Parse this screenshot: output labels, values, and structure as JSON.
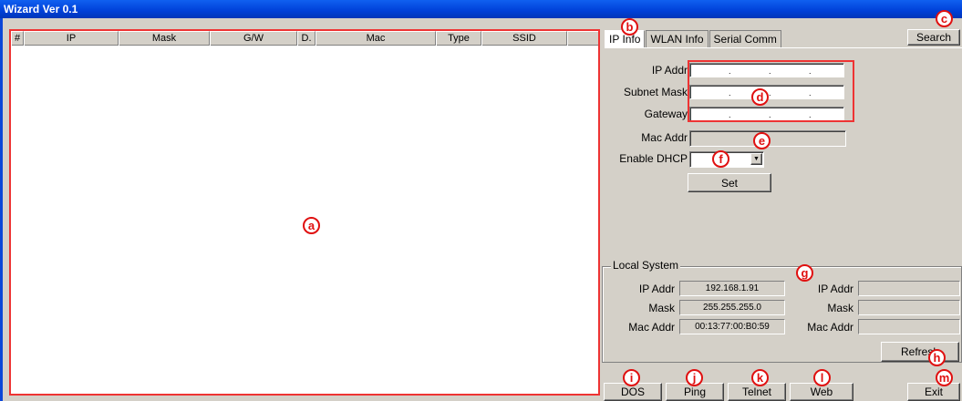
{
  "window": {
    "title": "Wizard Ver 0.1"
  },
  "device_list": {
    "columns": [
      "#",
      "IP",
      "Mask",
      "G/W",
      "D.",
      "Mac",
      "Type",
      "SSID"
    ],
    "marker": "a"
  },
  "tabs": [
    {
      "label": "IP Info",
      "active": true
    },
    {
      "label": "WLAN Info",
      "active": false
    },
    {
      "label": "Serial Comm",
      "active": false
    }
  ],
  "search_button": "Search",
  "ip_info": {
    "ip_addr_label": "IP Addr",
    "subnet_mask_label": "Subnet Mask",
    "gateway_label": "Gateway",
    "mac_addr_label": "Mac Addr",
    "enable_dhcp_label": "Enable DHCP",
    "dhcp_value": "",
    "set_button": "Set"
  },
  "local_system": {
    "legend": "Local System",
    "left": {
      "ip_label": "IP Addr",
      "ip_value": "192.168.1.91",
      "mask_label": "Mask",
      "mask_value": "255.255.255.0",
      "mac_label": "Mac Addr",
      "mac_value": "00:13:77:00:B0:59"
    },
    "right": {
      "ip_label": "IP Addr",
      "ip_value": "",
      "mask_label": "Mask",
      "mask_value": "",
      "mac_label": "Mac Addr",
      "mac_value": ""
    },
    "refresh_button": "Refresh"
  },
  "bottom_buttons": {
    "dos": "DOS",
    "ping": "Ping",
    "telnet": "Telnet",
    "web": "Web",
    "exit": "Exit"
  },
  "markers": {
    "a": "a",
    "b": "b",
    "c": "c",
    "d": "d",
    "e": "e",
    "f": "f",
    "g": "g",
    "h": "h",
    "i": "i",
    "j": "j",
    "k": "k",
    "l": "l",
    "m": "m"
  }
}
